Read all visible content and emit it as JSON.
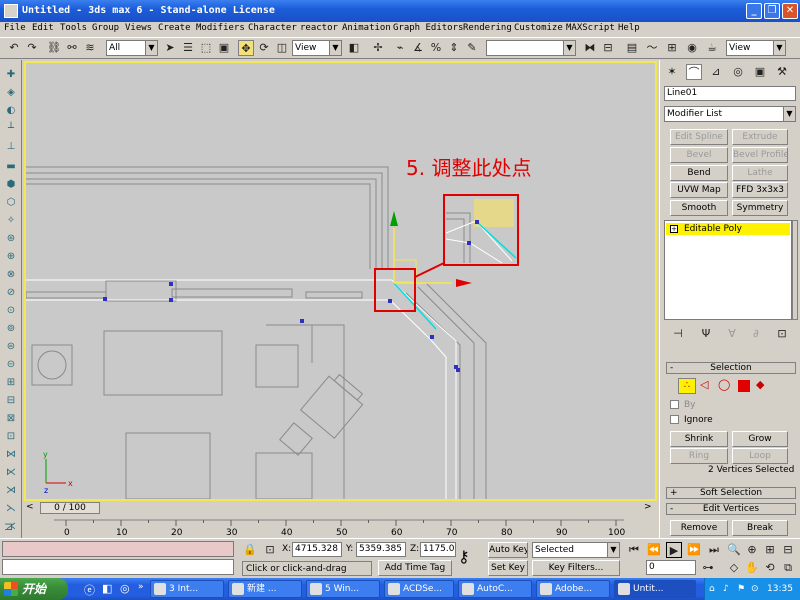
{
  "window": {
    "title": "Untitled - 3ds max 6 - Stand-alone License",
    "min": "_",
    "max": "❐",
    "close": "✕"
  },
  "menu": [
    "File",
    "Edit",
    "Tools",
    "Group",
    "Views",
    "Create",
    "Modifiers",
    "Character",
    "reactor",
    "Animation",
    "Graph Editors",
    "Rendering",
    "Customize",
    "MAXScript",
    "Help"
  ],
  "toolbar": {
    "selection_filter": "All",
    "ref_coord": "View",
    "named_selection": "",
    "render_view": "View"
  },
  "viewport": {
    "annotation": "5. 调整此处点",
    "axis_x": "x",
    "axis_y": "y",
    "axis_z": "z"
  },
  "timeline": {
    "frame": "0 / 100",
    "ticks": [
      "0",
      "10",
      "20",
      "30",
      "40",
      "50",
      "60",
      "70",
      "80",
      "90",
      "100"
    ]
  },
  "panel": {
    "object_name": "Line01",
    "modifier_list": "Modifier List",
    "buttons": [
      "Edit Spline",
      "Extrude",
      "Bevel",
      "Bevel Profile",
      "Bend",
      "Lathe",
      "UVW Map",
      "FFD 3x3x3",
      "Smooth",
      "Symmetry"
    ],
    "stack_item": "Editable Poly",
    "selection_title": "Selection",
    "by_label": "By",
    "ignore_label": "Ignore",
    "shrink": "Shrink",
    "grow": "Grow",
    "ring": "Ring",
    "loop": "Loop",
    "selected_info": "2 Vertices Selected",
    "soft_selection": "Soft Selection",
    "edit_vertices": "Edit Vertices",
    "remove": "Remove",
    "break": "Break",
    "sign_minus": "-",
    "sign_plus": "+"
  },
  "status": {
    "x_label": "X:",
    "x_value": "4715.328",
    "y_label": "Y:",
    "y_value": "5359.385",
    "z_label": "Z:",
    "z_value": "1175.0",
    "prompt": "Click or click-and-drag",
    "add_time_tag": "Add Time Tag",
    "auto_key": "Auto Key",
    "set_key": "Set Key",
    "key_mode": "Selected",
    "key_filters": "Key Filters...",
    "frame_field": "0"
  },
  "taskbar": {
    "start": "开始",
    "tasks": [
      "3 Int...",
      "新建 ...",
      "5 Win...",
      "ACDSe...",
      "AutoC...",
      "Adobe...",
      "Untit..."
    ],
    "clock": "13:35"
  },
  "colors": {
    "viewport_bg": "#c9c9c9",
    "viewport_border": "#f4e850",
    "annotation": "#e00000",
    "highlight_box": "#e00000",
    "vertex": "#3030c0",
    "selected_edge": "#00e0e0",
    "stack_highlight": "#fff200"
  }
}
